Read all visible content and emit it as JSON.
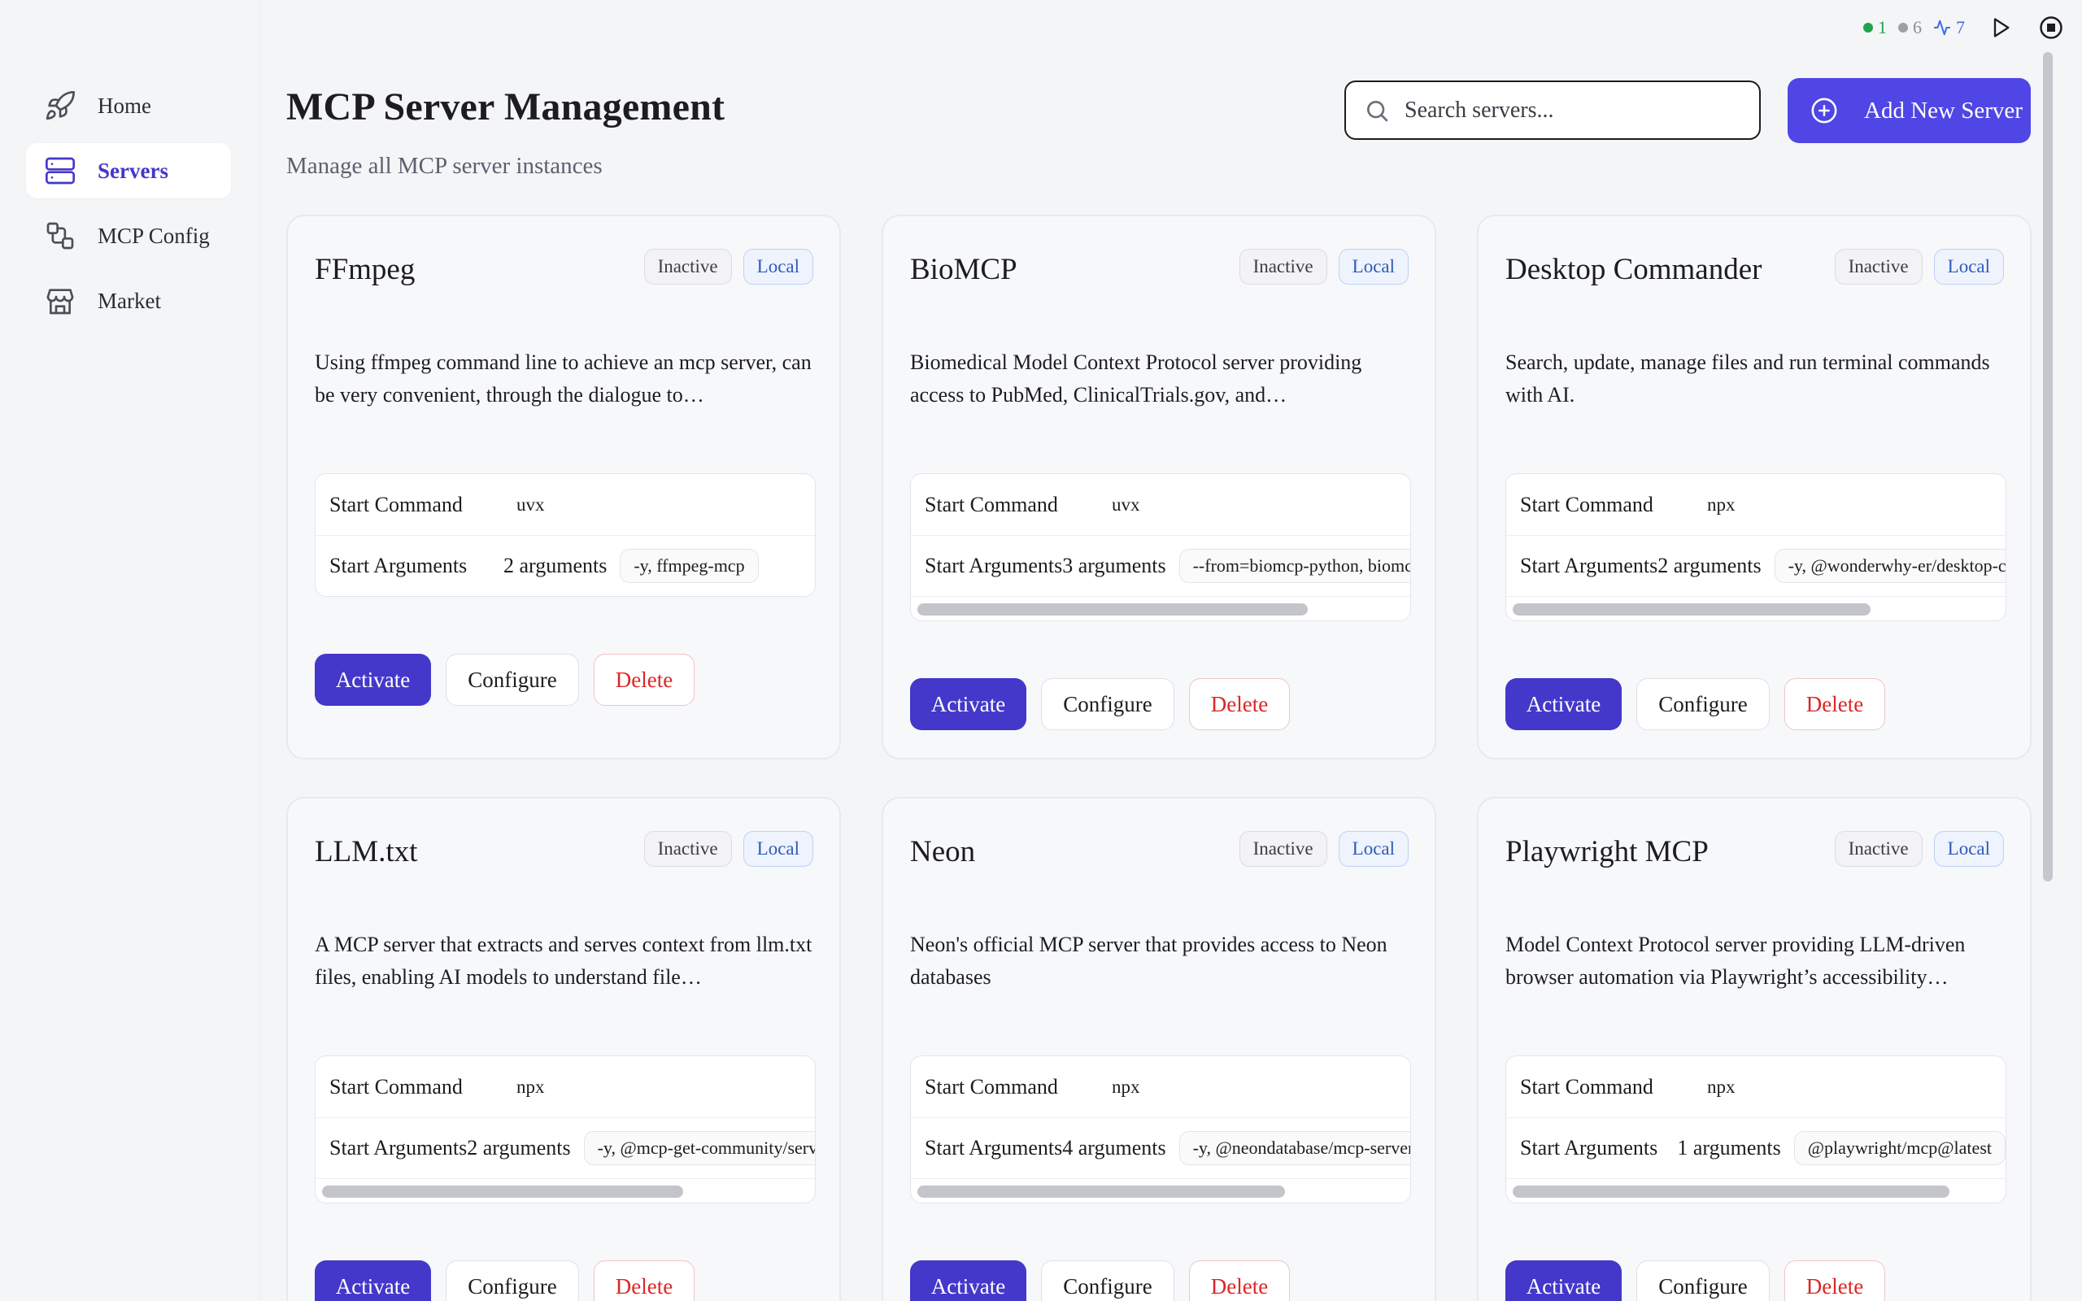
{
  "status": {
    "active_count": "1",
    "inactive_count": "6",
    "activity_count": "7",
    "colors": {
      "active": "#22a34b",
      "inactive": "#8a8f98",
      "activity": "#3b6fe0"
    }
  },
  "sidebar": {
    "items": [
      {
        "label": "Home",
        "icon": "rocket-icon"
      },
      {
        "label": "Servers",
        "icon": "server-icon"
      },
      {
        "label": "MCP Config",
        "icon": "config-icon"
      },
      {
        "label": "Market",
        "icon": "store-icon"
      }
    ],
    "active": "Servers"
  },
  "header": {
    "title": "MCP Server Management",
    "subtitle": "Manage all MCP server instances",
    "search_placeholder": "Search servers...",
    "add_button": "Add New Server"
  },
  "labels": {
    "start_command": "Start Command",
    "start_arguments": "Start Arguments",
    "activate": "Activate",
    "configure": "Configure",
    "delete": "Delete"
  },
  "servers": [
    {
      "name": "FFmpeg",
      "status": "Inactive",
      "type": "Local",
      "description": "Using ffmpeg command line to achieve an mcp server, can be very convenient, through the dialogue to…",
      "command": "uvx",
      "args_count": "2 arguments",
      "args": "-y, ffmpeg-mcp"
    },
    {
      "name": "BioMCP",
      "status": "Inactive",
      "type": "Local",
      "description": "Biomedical Model Context Protocol server providing access to PubMed, ClinicalTrials.gov, and…",
      "command": "uvx",
      "args_count": "3 arguments",
      "args": "--from=biomcp-python, biomcp, run"
    },
    {
      "name": "Desktop Commander",
      "status": "Inactive",
      "type": "Local",
      "description": "Search, update, manage files and run terminal commands with AI.",
      "command": "npx",
      "args_count": "2 arguments",
      "args": "-y, @wonderwhy-er/desktop-commander"
    },
    {
      "name": "LLM.txt",
      "status": "Inactive",
      "type": "Local",
      "description": "A MCP server that extracts and serves context from llm.txt files, enabling AI models to understand file…",
      "command": "npx",
      "args_count": "2 arguments",
      "args": "-y, @mcp-get-community/server-llm-txt"
    },
    {
      "name": "Neon",
      "status": "Inactive",
      "type": "Local",
      "description": "Neon's official MCP server that provides access to Neon databases",
      "command": "npx",
      "args_count": "4 arguments",
      "args": "-y, @neondatabase/mcp-server-neon, start, <API_KEY>"
    },
    {
      "name": "Playwright MCP",
      "status": "Inactive",
      "type": "Local",
      "description": "Model Context Protocol server providing LLM-driven browser automation via Playwright’s accessibility…",
      "command": "npx",
      "args_count": "1 arguments",
      "args": "@playwright/mcp@latest"
    }
  ]
}
